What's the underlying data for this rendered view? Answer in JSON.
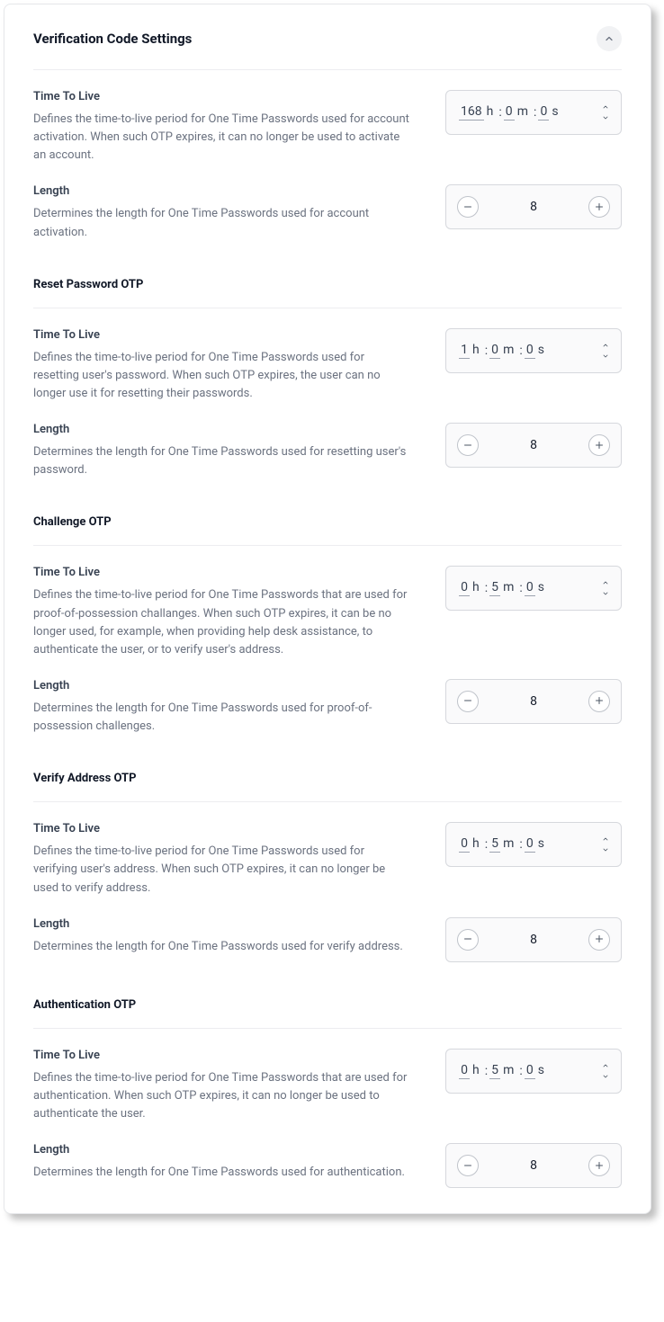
{
  "header": {
    "title": "Verification Code Settings"
  },
  "sections": [
    {
      "key": "activation",
      "title": null,
      "ttl": {
        "label": "Time To Live",
        "desc": "Defines the time-to-live period for One Time Passwords used for account activation. When such OTP expires, it can no longer be used to activate an account.",
        "h": "168",
        "m": "0",
        "s": "0",
        "uh": "h",
        "um": "m",
        "us": "s",
        "colon": ":"
      },
      "len": {
        "label": "Length",
        "desc": "Determines the length for One Time Passwords used for account activation.",
        "value": "8"
      }
    },
    {
      "key": "reset",
      "title": "Reset Password OTP",
      "ttl": {
        "label": "Time To Live",
        "desc": "Defines the time-to-live period for One Time Passwords used for resetting user's password. When such OTP expires, the user can no longer use it for resetting their passwords.",
        "h": "1",
        "m": "0",
        "s": "0",
        "uh": "h",
        "um": "m",
        "us": "s",
        "colon": ":"
      },
      "len": {
        "label": "Length",
        "desc": "Determines the length for One Time Passwords used for resetting user's password.",
        "value": "8"
      }
    },
    {
      "key": "challenge",
      "title": "Challenge OTP",
      "ttl": {
        "label": "Time To Live",
        "desc": "Defines the time-to-live period for One Time Passwords that are used for proof-of-possession challanges. When such OTP expires, it can be no longer used, for example, when providing help desk assistance, to authenticate the user, or to verify user's address.",
        "h": "0",
        "m": "5",
        "s": "0",
        "uh": "h",
        "um": "m",
        "us": "s",
        "colon": ":"
      },
      "len": {
        "label": "Length",
        "desc": "Determines the length for One Time Passwords used for proof-of-possession challenges.",
        "value": "8"
      }
    },
    {
      "key": "verify",
      "title": "Verify Address OTP",
      "ttl": {
        "label": "Time To Live",
        "desc": "Defines the time-to-live period for One Time Passwords used for verifying user's address. When such OTP expires, it can no longer be used to verify address.",
        "h": "0",
        "m": "5",
        "s": "0",
        "uh": "h",
        "um": "m",
        "us": "s",
        "colon": ":"
      },
      "len": {
        "label": "Length",
        "desc": "Determines the length for One Time Passwords used for verify address.",
        "value": "8"
      }
    },
    {
      "key": "auth",
      "title": "Authentication OTP",
      "ttl": {
        "label": "Time To Live",
        "desc": "Defines the time-to-live period for One Time Passwords that are used for authentication. When such OTP expires, it can no longer be used to authenticate the user.",
        "h": "0",
        "m": "5",
        "s": "0",
        "uh": "h",
        "um": "m",
        "us": "s",
        "colon": ":"
      },
      "len": {
        "label": "Length",
        "desc": "Determines the length for One Time Passwords used for authentication.",
        "value": "8"
      }
    }
  ]
}
